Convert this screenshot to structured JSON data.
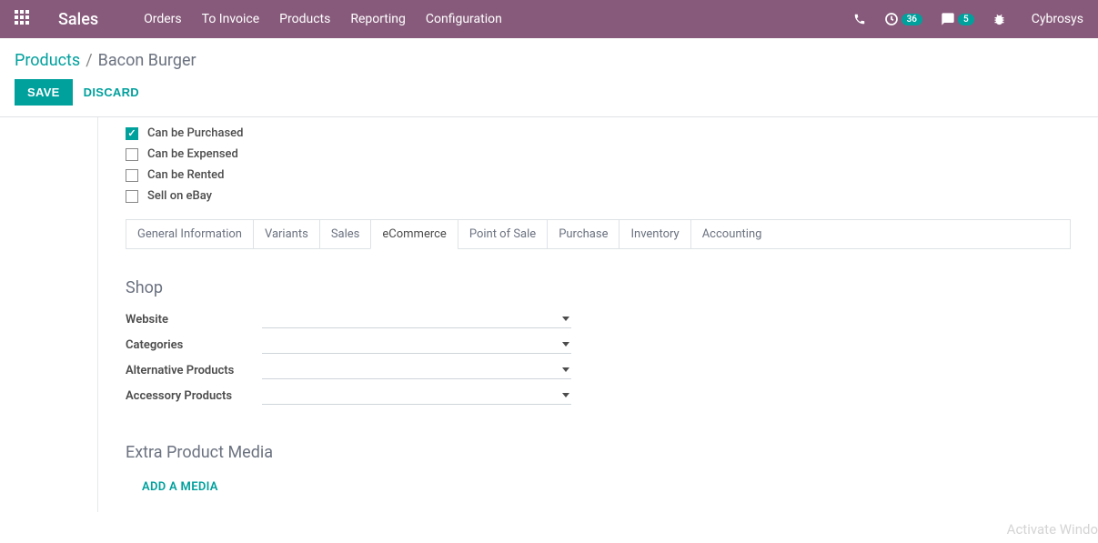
{
  "nav": {
    "app_title": "Sales",
    "menu": [
      "Orders",
      "To Invoice",
      "Products",
      "Reporting",
      "Configuration"
    ],
    "clock_badge": "36",
    "chat_badge": "5",
    "username": "Cybrosys"
  },
  "breadcrumb": {
    "parent": "Products",
    "current": "Bacon Burger"
  },
  "actions": {
    "save": "SAVE",
    "discard": "DISCARD"
  },
  "checkboxes": [
    {
      "label": "Can be Purchased",
      "checked": true
    },
    {
      "label": "Can be Expensed",
      "checked": false
    },
    {
      "label": "Can be Rented",
      "checked": false
    },
    {
      "label": "Sell on eBay",
      "checked": false
    }
  ],
  "tabs": [
    "General Information",
    "Variants",
    "Sales",
    "eCommerce",
    "Point of Sale",
    "Purchase",
    "Inventory",
    "Accounting"
  ],
  "active_tab": "eCommerce",
  "sections": {
    "shop_title": "Shop",
    "shop_fields": [
      "Website",
      "Categories",
      "Alternative Products",
      "Accessory Products"
    ],
    "media_title": "Extra Product Media",
    "add_media": "ADD A MEDIA"
  },
  "watermark": "Activate Windo"
}
